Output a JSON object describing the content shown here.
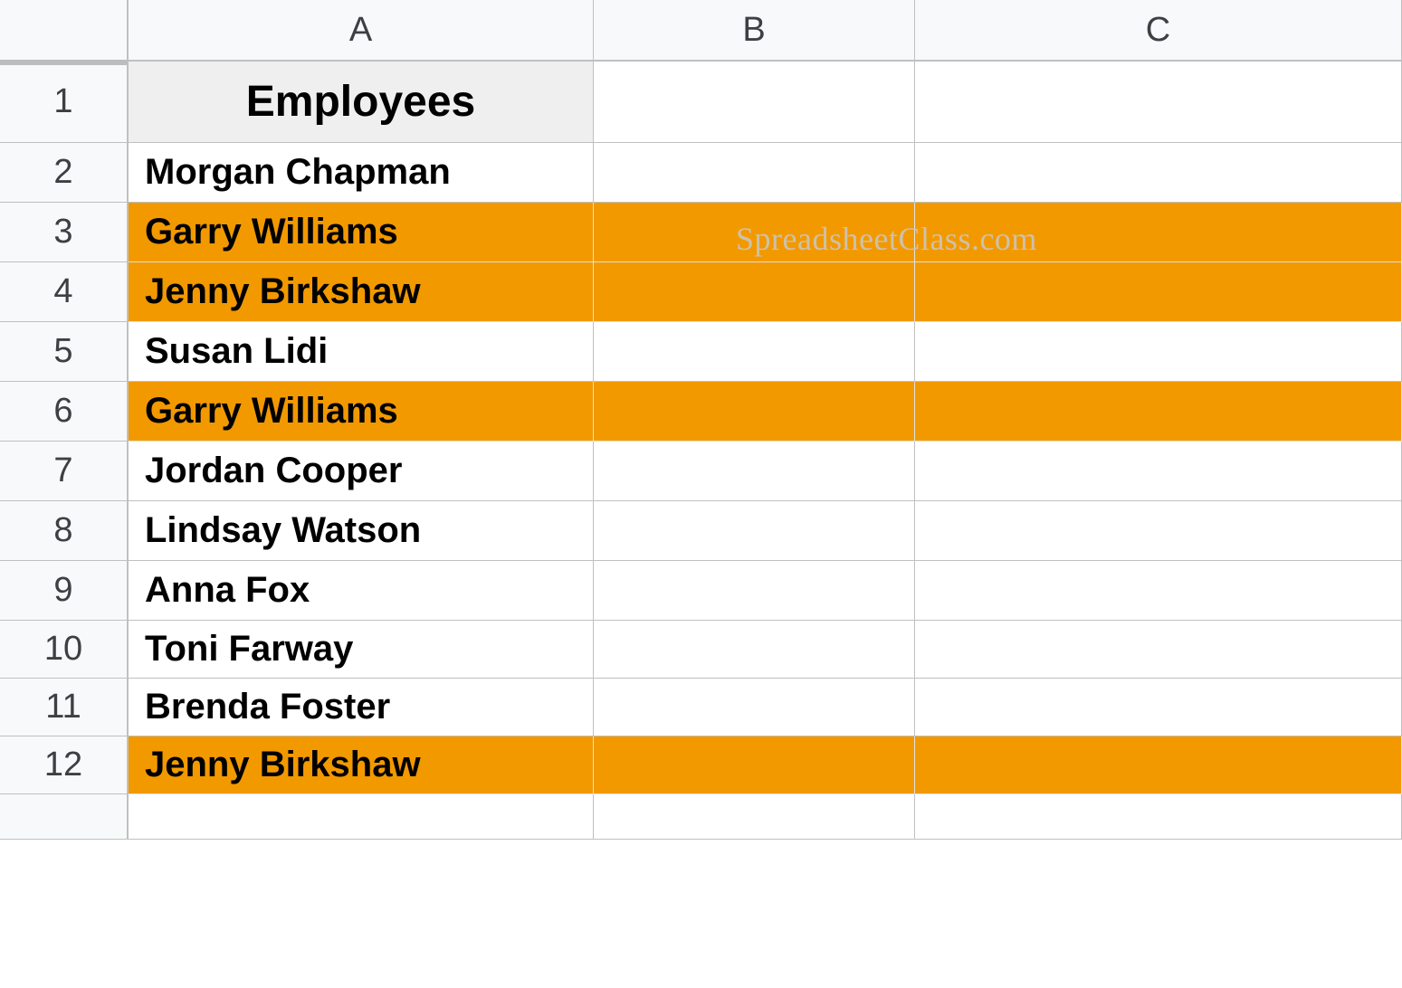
{
  "columns": [
    "A",
    "B",
    "C"
  ],
  "row_numbers": [
    1,
    2,
    3,
    4,
    5,
    6,
    7,
    8,
    9,
    10,
    11,
    12
  ],
  "header_label": "Employees",
  "employees": [
    "Morgan Chapman",
    "Garry Williams",
    "Jenny Birkshaw",
    "Susan Lidi",
    "Garry Williams",
    "Jordan Cooper",
    "Lindsay Watson",
    "Anna Fox",
    "Toni Farway",
    "Brenda Foster",
    "Jenny Birkshaw"
  ],
  "highlighted_rows": [
    3,
    4,
    6,
    12
  ],
  "watermark": "SpreadsheetClass.com",
  "highlight_color": "#f29900"
}
